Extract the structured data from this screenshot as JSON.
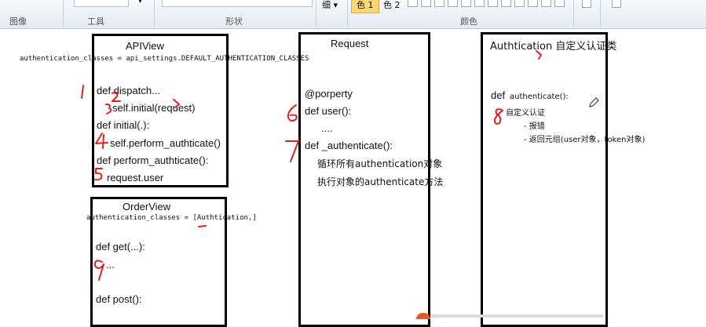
{
  "ribbon": {
    "groups": {
      "image": "图像",
      "tools": "工具",
      "shapes": "形状",
      "colors": "颜色"
    },
    "size_label": "细",
    "color1_label": "色 1",
    "color2_label": "色 2",
    "icons": [
      "dropdown-arrow-icon",
      "brush-icon",
      "shape-outline-icon"
    ]
  },
  "apiview": {
    "title": "APIView",
    "auth_classes": "authentication_classes = api_settings.DEFAULT_AUTHENTICATION_CLASSES",
    "lines": [
      "def dispatch...",
      "self.initial(request)",
      "def initial(.):",
      "self.perform_authticate()",
      "def perform_authticate():",
      "request.user"
    ]
  },
  "orderview": {
    "title": "OrderView",
    "auth_classes": "authentication_classes = [Authtication,]",
    "lines": [
      "def get(...):",
      "...",
      "def post():"
    ]
  },
  "request": {
    "title": "Request",
    "lines": [
      "@porperty",
      "def user():",
      "....",
      "def _authenticate():",
      "循环所有authentication对象",
      "执行对象的authenticate方法"
    ]
  },
  "authtication": {
    "title": "Authtication 自定义认证类",
    "def_kw": "def",
    "method": "authenticate():",
    "notes": [
      "自定义认证",
      "- 报错",
      "- 返回元组(user对象，token对象)"
    ]
  },
  "annotations": [
    "1",
    "2",
    "3",
    "4",
    "5",
    "6",
    "7",
    "8",
    "9"
  ],
  "colors": {
    "ink": "#000000",
    "annotation": "#e02020",
    "ribbon_active": "#fbd775"
  }
}
